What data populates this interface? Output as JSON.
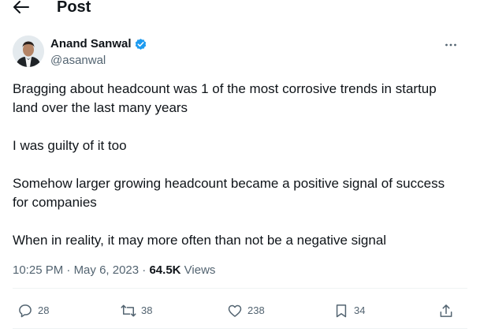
{
  "header": {
    "title": "Post",
    "back_icon": "arrow-left-icon"
  },
  "author": {
    "name": "Anand Sanwal",
    "handle": "@asanwal",
    "verified_icon": "verified-badge-icon",
    "verified_color": "#1d9bf0"
  },
  "more_icon": "more-horizontal-icon",
  "tweet": {
    "paragraphs": [
      "Bragging about headcount was 1 of the most corrosive trends in startup land over the last many years",
      "I was guilty of it too",
      "Somehow larger growing headcount became a positive signal of success for companies",
      "When in reality, it may more often than not be a negative signal"
    ]
  },
  "meta": {
    "time": "10:25 PM",
    "date": "May 6, 2023",
    "views_count": "64.5K",
    "views_label": "Views",
    "separator": "·"
  },
  "actions": {
    "reply": {
      "icon": "reply-icon",
      "count": "28"
    },
    "repost": {
      "icon": "repost-icon",
      "count": "38"
    },
    "like": {
      "icon": "heart-icon",
      "count": "238"
    },
    "bookmark": {
      "icon": "bookmark-icon",
      "count": "34"
    },
    "share": {
      "icon": "share-icon"
    }
  },
  "colors": {
    "text": "#0f1419",
    "muted": "#536471",
    "divider": "#eff3f4"
  }
}
